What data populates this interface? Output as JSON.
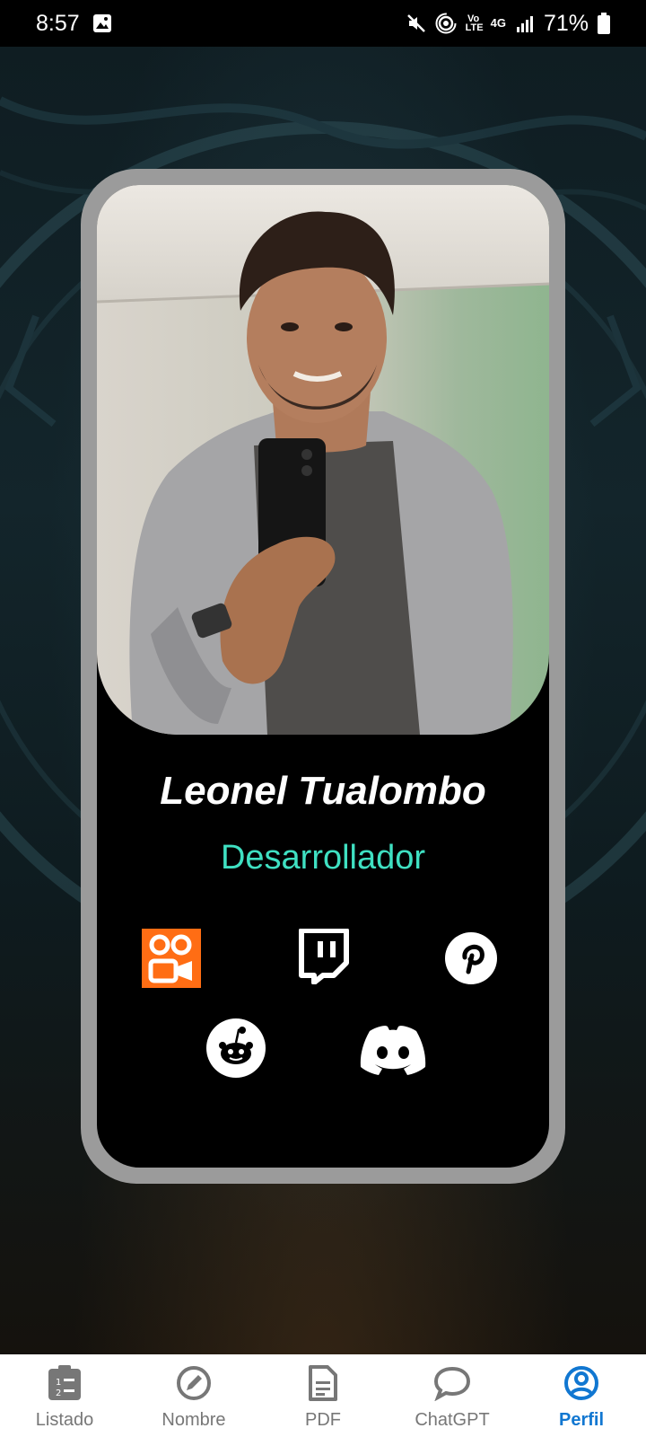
{
  "status_bar": {
    "time": "8:57",
    "volte_label": "Vo LTE",
    "network": "4G",
    "battery": "71%"
  },
  "profile": {
    "name": "Leonel Tualombo",
    "role": "Desarrollador",
    "photo_alt": "profile-photo"
  },
  "socials": [
    {
      "icon": "kuaishou-icon"
    },
    {
      "icon": "twitch-icon"
    },
    {
      "icon": "pinterest-icon"
    },
    {
      "icon": "reddit-icon"
    },
    {
      "icon": "discord-icon"
    }
  ],
  "nav": {
    "items": [
      {
        "label": "Listado",
        "icon": "list-icon"
      },
      {
        "label": "Nombre",
        "icon": "edit-icon"
      },
      {
        "label": "PDF",
        "icon": "document-icon"
      },
      {
        "label": "ChatGPT",
        "icon": "chat-icon"
      },
      {
        "label": "Perfil",
        "icon": "profile-icon"
      }
    ],
    "active_index": 4
  },
  "colors": {
    "accent": "#1177d1",
    "role_text": "#3fe0c2",
    "card_frame": "#9b9b9b",
    "kuaishou_orange": "#ff6d14"
  }
}
